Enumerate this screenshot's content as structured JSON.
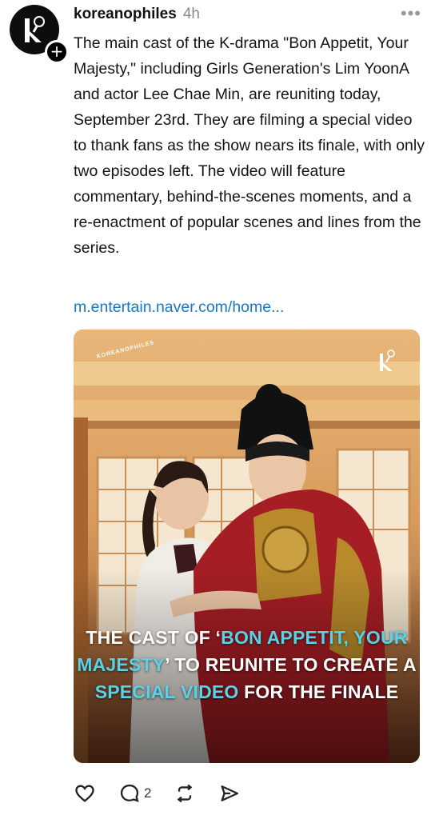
{
  "post": {
    "username": "koreanophiles",
    "time": "4h",
    "more_label": "•••",
    "follow_icon": "+",
    "text": "The main cast of the K-drama \"Bon Appetit, Your Majesty,\" including Girls Generation's Lim YoonA and actor Lee Chae Min, are reuniting today, September 23rd. They are filming a special video to thank fans as the show nears its finale, with only two episodes left. The video will feature commentary, behind-the-scenes moments, and a re-enactment of popular scenes and lines from the series.",
    "link": "m.entertain.naver.com/home..."
  },
  "media": {
    "watermark": "KOREANOPHILES",
    "headline": {
      "part1": "THE CAST OF ‘",
      "hl1": "BON APPETIT, YOUR MAJESTY",
      "part2": "’ TO REUNITE TO CREATE A ",
      "hl2": "SPECIAL VIDEO",
      "part3": " FOR THE FINALE"
    },
    "highlight_color": "#5ad1e6"
  },
  "actions": {
    "like_icon": "heart-icon",
    "comment_icon": "comment-icon",
    "comment_count": "2",
    "repost_icon": "repost-icon",
    "share_icon": "share-icon"
  },
  "colors": {
    "link": "#1878c8",
    "muted": "#8a8a8a"
  }
}
